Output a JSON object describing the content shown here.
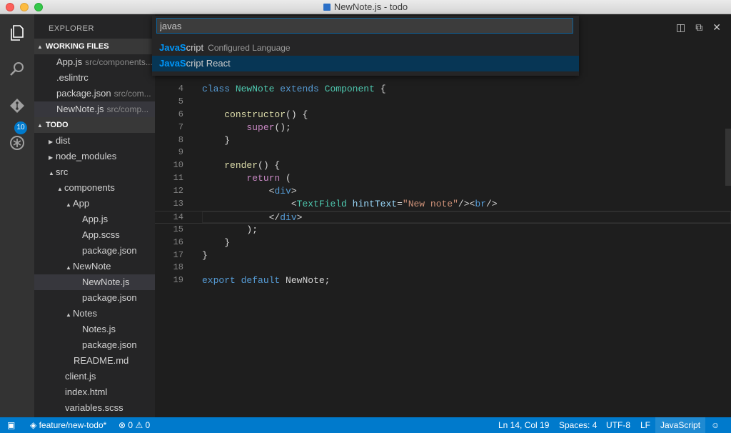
{
  "window": {
    "title": "NewNote.js - todo"
  },
  "activity_bar": {
    "badge": "10"
  },
  "sidebar": {
    "title": "EXPLORER",
    "working_files_header": "WORKING FILES",
    "working_files": [
      {
        "name": "App.js",
        "path": "src/components..."
      },
      {
        "name": ".eslintrc",
        "path": ""
      },
      {
        "name": "package.json",
        "path": "src/com..."
      },
      {
        "name": "NewNote.js",
        "path": "src/comp..."
      }
    ],
    "project_header": "TODO",
    "tree": [
      {
        "label": "dist"
      },
      {
        "label": "node_modules"
      },
      {
        "label": "src"
      },
      {
        "label": "components"
      },
      {
        "label": "App"
      },
      {
        "label": "App.js"
      },
      {
        "label": "App.scss"
      },
      {
        "label": "package.json"
      },
      {
        "label": "NewNote"
      },
      {
        "label": "NewNote.js"
      },
      {
        "label": "package.json"
      },
      {
        "label": "Notes"
      },
      {
        "label": "Notes.js"
      },
      {
        "label": "package.json"
      },
      {
        "label": "README.md"
      },
      {
        "label": "client.js"
      },
      {
        "label": "index.html"
      },
      {
        "label": "variables.scss"
      }
    ]
  },
  "quick_open": {
    "input_value": "javas",
    "items": [
      {
        "match": "JavaS",
        "rest": "cript",
        "description": "Configured Language"
      },
      {
        "match": "JavaS",
        "rest": "cript React",
        "description": ""
      }
    ]
  },
  "editor": {
    "line_numbers": [
      "4",
      "5",
      "6",
      "7",
      "8",
      "9",
      "10",
      "11",
      "12",
      "13",
      "14",
      "15",
      "16",
      "17",
      "18",
      "19"
    ]
  },
  "status_bar": {
    "branch": "feature/new-todo*",
    "errors": "0",
    "warnings": "0",
    "position": "Ln 14, Col 19",
    "spaces": "Spaces: 4",
    "encoding": "UTF-8",
    "eol": "LF",
    "language": "JavaScript"
  }
}
